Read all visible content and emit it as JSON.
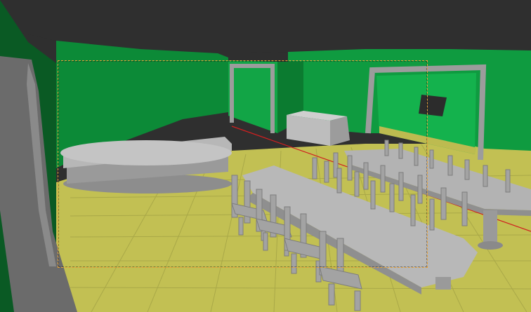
{
  "viewport": {
    "mode": "solid-viewport",
    "has_camera_frame": true
  },
  "scene": {
    "objects": [
      "ceiling",
      "back-wall",
      "left-wall",
      "floor-grid",
      "doorway-left",
      "doorway-right",
      "reception-counter",
      "cabinet",
      "wall-tv",
      "dining-table-front",
      "dining-table-back",
      "chairs"
    ]
  },
  "colors": {
    "ceiling": "#2f2f2f",
    "wall_main": "#0c9a3c",
    "wall_dark": "#0b6c2a",
    "floor": "#c0bf52",
    "floor_grid": "#a8a748",
    "furniture": "#a9a9a9",
    "furniture_shadow": "#7d7d7d",
    "camera_frame": "#e8a23a",
    "axis_line": "#d02020"
  }
}
